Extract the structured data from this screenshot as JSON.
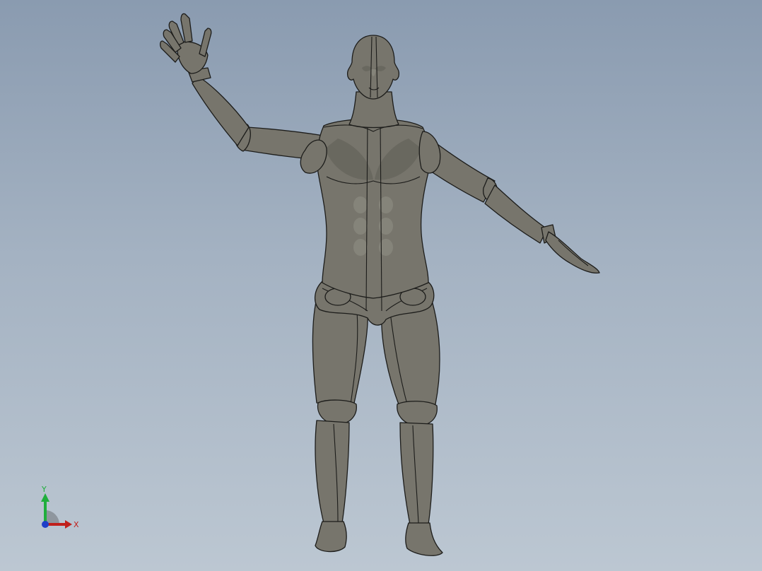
{
  "viewport": {
    "background_top": "#8a9bb0",
    "background_bottom": "#bcc7d2",
    "model_color": "#77756c",
    "edge_color": "#1c1c1a"
  },
  "triad": {
    "x_label": "X",
    "y_label": "Y",
    "x_color": "#c0201c",
    "y_color": "#1fae3c",
    "z_color": "#1f3fc8"
  }
}
